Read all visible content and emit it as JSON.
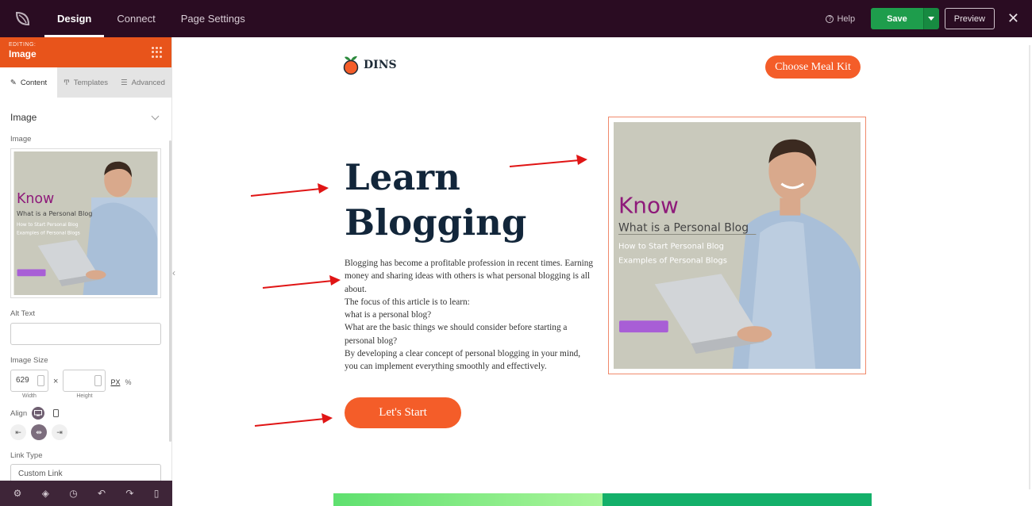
{
  "topbar": {
    "tabs": [
      {
        "label": "Design",
        "active": true
      },
      {
        "label": "Connect",
        "active": false
      },
      {
        "label": "Page Settings",
        "active": false
      }
    ],
    "help_label": "Help",
    "save_label": "Save",
    "preview_label": "Preview"
  },
  "sidebar": {
    "editing_label": "EDITING:",
    "editing_title": "Image",
    "tabs": [
      {
        "label": "Content",
        "active": true
      },
      {
        "label": "Templates",
        "active": false
      },
      {
        "label": "Advanced",
        "active": false
      }
    ],
    "section_title": "Image",
    "image_label": "Image",
    "alt_text_label": "Alt Text",
    "alt_text_value": "",
    "image_size_label": "Image Size",
    "width_value": "629",
    "height_value": "",
    "width_label": "Width",
    "height_label": "Height",
    "unit_px": "PX",
    "unit_percent": "%",
    "align_label": "Align",
    "link_type_label": "Link Type",
    "link_type_value": "Custom Link"
  },
  "site": {
    "brand": "DINS",
    "meal_button": "Choose Meal Kit",
    "hero_title_line1": "Learn",
    "hero_title_line2": "Blogging",
    "hero_body": [
      "Blogging has become a profitable profession in recent times. Earning money and sharing ideas with others is what personal blogging is all about.",
      "The focus of this article is to learn:",
      "what is a personal blog?",
      "What are the basic things we should consider before starting a personal blog?",
      "By developing a clear concept of personal blogging in your mind, you can implement everything smoothly and effectively."
    ],
    "start_button": "Let's Start"
  },
  "blog_image": {
    "heading": "Know",
    "subheading": "What is a Personal Blog",
    "line1": "How to Start Personal Blog",
    "line2": "Examples of Personal Blogs"
  },
  "colors": {
    "accent_orange": "#f45d29",
    "topbar_bg": "#2a0c22",
    "save_green": "#1e9d4c",
    "know_purple": "#8e1a7a",
    "arrow_red": "#e01515"
  },
  "icons": [
    "seedprod-logo-icon",
    "help-icon",
    "caret-down-icon",
    "close-icon",
    "grid-dots-icon",
    "pencil-icon",
    "templates-icon",
    "sliders-icon",
    "chevron-down-icon",
    "desktop-icon",
    "mobile-icon",
    "align-left-icon",
    "align-center-icon",
    "align-right-icon",
    "gear-icon",
    "layers-icon",
    "history-icon",
    "undo-icon",
    "redo-icon",
    "mobile-preview-icon",
    "orange-fruit-icon",
    "collapse-arrow-icon"
  ]
}
